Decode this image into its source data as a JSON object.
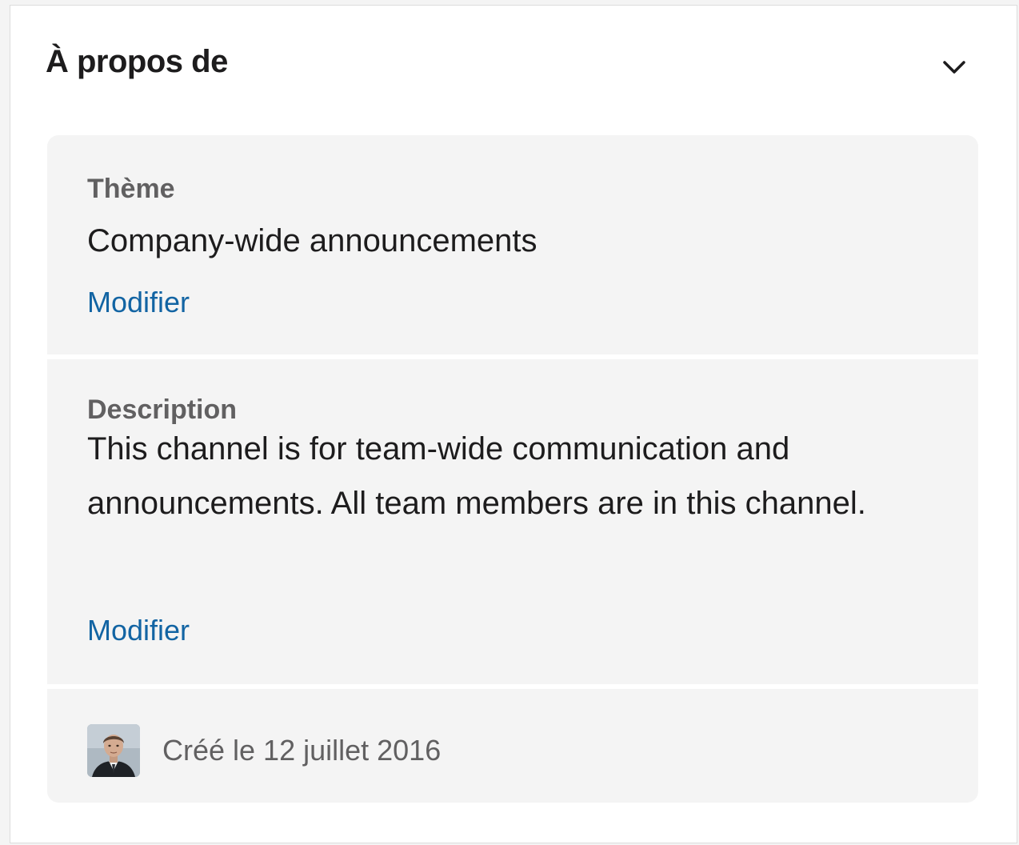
{
  "about": {
    "title": "À propos de",
    "toggle_icon": "chevron-down-icon"
  },
  "topic": {
    "label": "Thème",
    "value": "Company-wide announcements",
    "edit_label": "Modifier"
  },
  "description": {
    "label": "Description",
    "value": "This channel is for team-wide communication and announcements. All team members are in this channel.",
    "edit_label": "Modifier"
  },
  "created": {
    "text": "Créé le 12 juillet 2016",
    "avatar": "user-avatar"
  },
  "colors": {
    "link": "#1264a3",
    "card_background": "#f4f4f4",
    "title": "#1d1c1d",
    "muted": "#616061"
  }
}
